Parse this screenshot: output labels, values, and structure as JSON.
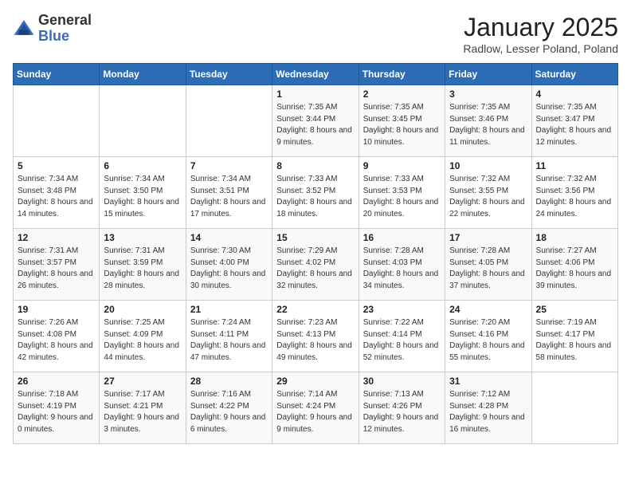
{
  "header": {
    "logo": {
      "general": "General",
      "blue": "Blue"
    },
    "month": "January 2025",
    "location": "Radlow, Lesser Poland, Poland"
  },
  "weekdays": [
    "Sunday",
    "Monday",
    "Tuesday",
    "Wednesday",
    "Thursday",
    "Friday",
    "Saturday"
  ],
  "weeks": [
    [
      {
        "day": "",
        "sunrise": "",
        "sunset": "",
        "daylight": ""
      },
      {
        "day": "",
        "sunrise": "",
        "sunset": "",
        "daylight": ""
      },
      {
        "day": "",
        "sunrise": "",
        "sunset": "",
        "daylight": ""
      },
      {
        "day": "1",
        "sunrise": "Sunrise: 7:35 AM",
        "sunset": "Sunset: 3:44 PM",
        "daylight": "Daylight: 8 hours and 9 minutes."
      },
      {
        "day": "2",
        "sunrise": "Sunrise: 7:35 AM",
        "sunset": "Sunset: 3:45 PM",
        "daylight": "Daylight: 8 hours and 10 minutes."
      },
      {
        "day": "3",
        "sunrise": "Sunrise: 7:35 AM",
        "sunset": "Sunset: 3:46 PM",
        "daylight": "Daylight: 8 hours and 11 minutes."
      },
      {
        "day": "4",
        "sunrise": "Sunrise: 7:35 AM",
        "sunset": "Sunset: 3:47 PM",
        "daylight": "Daylight: 8 hours and 12 minutes."
      }
    ],
    [
      {
        "day": "5",
        "sunrise": "Sunrise: 7:34 AM",
        "sunset": "Sunset: 3:48 PM",
        "daylight": "Daylight: 8 hours and 14 minutes."
      },
      {
        "day": "6",
        "sunrise": "Sunrise: 7:34 AM",
        "sunset": "Sunset: 3:50 PM",
        "daylight": "Daylight: 8 hours and 15 minutes."
      },
      {
        "day": "7",
        "sunrise": "Sunrise: 7:34 AM",
        "sunset": "Sunset: 3:51 PM",
        "daylight": "Daylight: 8 hours and 17 minutes."
      },
      {
        "day": "8",
        "sunrise": "Sunrise: 7:33 AM",
        "sunset": "Sunset: 3:52 PM",
        "daylight": "Daylight: 8 hours and 18 minutes."
      },
      {
        "day": "9",
        "sunrise": "Sunrise: 7:33 AM",
        "sunset": "Sunset: 3:53 PM",
        "daylight": "Daylight: 8 hours and 20 minutes."
      },
      {
        "day": "10",
        "sunrise": "Sunrise: 7:32 AM",
        "sunset": "Sunset: 3:55 PM",
        "daylight": "Daylight: 8 hours and 22 minutes."
      },
      {
        "day": "11",
        "sunrise": "Sunrise: 7:32 AM",
        "sunset": "Sunset: 3:56 PM",
        "daylight": "Daylight: 8 hours and 24 minutes."
      }
    ],
    [
      {
        "day": "12",
        "sunrise": "Sunrise: 7:31 AM",
        "sunset": "Sunset: 3:57 PM",
        "daylight": "Daylight: 8 hours and 26 minutes."
      },
      {
        "day": "13",
        "sunrise": "Sunrise: 7:31 AM",
        "sunset": "Sunset: 3:59 PM",
        "daylight": "Daylight: 8 hours and 28 minutes."
      },
      {
        "day": "14",
        "sunrise": "Sunrise: 7:30 AM",
        "sunset": "Sunset: 4:00 PM",
        "daylight": "Daylight: 8 hours and 30 minutes."
      },
      {
        "day": "15",
        "sunrise": "Sunrise: 7:29 AM",
        "sunset": "Sunset: 4:02 PM",
        "daylight": "Daylight: 8 hours and 32 minutes."
      },
      {
        "day": "16",
        "sunrise": "Sunrise: 7:28 AM",
        "sunset": "Sunset: 4:03 PM",
        "daylight": "Daylight: 8 hours and 34 minutes."
      },
      {
        "day": "17",
        "sunrise": "Sunrise: 7:28 AM",
        "sunset": "Sunset: 4:05 PM",
        "daylight": "Daylight: 8 hours and 37 minutes."
      },
      {
        "day": "18",
        "sunrise": "Sunrise: 7:27 AM",
        "sunset": "Sunset: 4:06 PM",
        "daylight": "Daylight: 8 hours and 39 minutes."
      }
    ],
    [
      {
        "day": "19",
        "sunrise": "Sunrise: 7:26 AM",
        "sunset": "Sunset: 4:08 PM",
        "daylight": "Daylight: 8 hours and 42 minutes."
      },
      {
        "day": "20",
        "sunrise": "Sunrise: 7:25 AM",
        "sunset": "Sunset: 4:09 PM",
        "daylight": "Daylight: 8 hours and 44 minutes."
      },
      {
        "day": "21",
        "sunrise": "Sunrise: 7:24 AM",
        "sunset": "Sunset: 4:11 PM",
        "daylight": "Daylight: 8 hours and 47 minutes."
      },
      {
        "day": "22",
        "sunrise": "Sunrise: 7:23 AM",
        "sunset": "Sunset: 4:13 PM",
        "daylight": "Daylight: 8 hours and 49 minutes."
      },
      {
        "day": "23",
        "sunrise": "Sunrise: 7:22 AM",
        "sunset": "Sunset: 4:14 PM",
        "daylight": "Daylight: 8 hours and 52 minutes."
      },
      {
        "day": "24",
        "sunrise": "Sunrise: 7:20 AM",
        "sunset": "Sunset: 4:16 PM",
        "daylight": "Daylight: 8 hours and 55 minutes."
      },
      {
        "day": "25",
        "sunrise": "Sunrise: 7:19 AM",
        "sunset": "Sunset: 4:17 PM",
        "daylight": "Daylight: 8 hours and 58 minutes."
      }
    ],
    [
      {
        "day": "26",
        "sunrise": "Sunrise: 7:18 AM",
        "sunset": "Sunset: 4:19 PM",
        "daylight": "Daylight: 9 hours and 0 minutes."
      },
      {
        "day": "27",
        "sunrise": "Sunrise: 7:17 AM",
        "sunset": "Sunset: 4:21 PM",
        "daylight": "Daylight: 9 hours and 3 minutes."
      },
      {
        "day": "28",
        "sunrise": "Sunrise: 7:16 AM",
        "sunset": "Sunset: 4:22 PM",
        "daylight": "Daylight: 9 hours and 6 minutes."
      },
      {
        "day": "29",
        "sunrise": "Sunrise: 7:14 AM",
        "sunset": "Sunset: 4:24 PM",
        "daylight": "Daylight: 9 hours and 9 minutes."
      },
      {
        "day": "30",
        "sunrise": "Sunrise: 7:13 AM",
        "sunset": "Sunset: 4:26 PM",
        "daylight": "Daylight: 9 hours and 12 minutes."
      },
      {
        "day": "31",
        "sunrise": "Sunrise: 7:12 AM",
        "sunset": "Sunset: 4:28 PM",
        "daylight": "Daylight: 9 hours and 16 minutes."
      },
      {
        "day": "",
        "sunrise": "",
        "sunset": "",
        "daylight": ""
      }
    ]
  ]
}
